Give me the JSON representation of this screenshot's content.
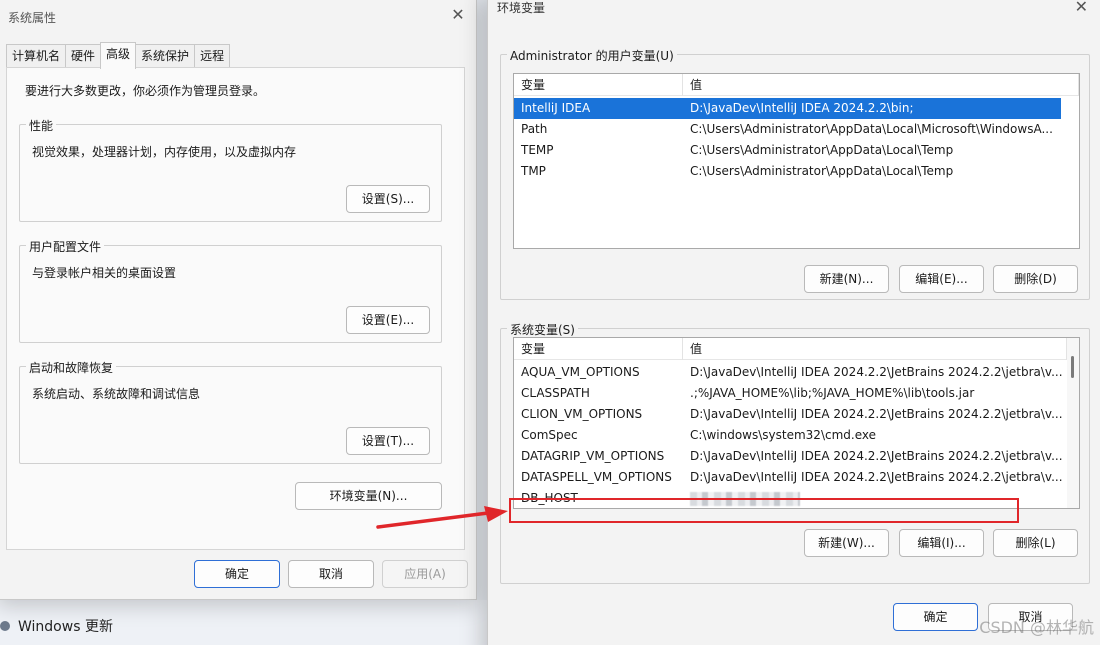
{
  "sys_props": {
    "title": "系统属性",
    "tabs": [
      "计算机名",
      "硬件",
      "高级",
      "系统保护",
      "远程"
    ],
    "active_tab": "高级",
    "admin_note": "要进行大多数更改，你必须作为管理员登录。",
    "performance": {
      "legend": "性能",
      "desc": "视觉效果，处理器计划，内存使用，以及虚拟内存",
      "button": "设置(S)..."
    },
    "user_profiles": {
      "legend": "用户配置文件",
      "desc": "与登录帐户相关的桌面设置",
      "button": "设置(E)..."
    },
    "startup_recovery": {
      "legend": "启动和故障恢复",
      "desc": "系统启动、系统故障和调试信息",
      "button": "设置(T)..."
    },
    "env_button": "环境变量(N)...",
    "ok": "确定",
    "cancel": "取消",
    "apply": "应用(A)"
  },
  "background": {
    "windows_update": "Windows 更新"
  },
  "env_dialog": {
    "title": "环境变量",
    "user_vars": {
      "legend": "Administrator 的用户变量(U)",
      "col_var": "变量",
      "col_val": "值",
      "rows": [
        {
          "name": "IntelliJ IDEA",
          "value": "D:\\JavaDev\\IntelliJ IDEA 2024.2.2\\bin;"
        },
        {
          "name": "Path",
          "value": "C:\\Users\\Administrator\\AppData\\Local\\Microsoft\\WindowsA..."
        },
        {
          "name": "TEMP",
          "value": "C:\\Users\\Administrator\\AppData\\Local\\Temp"
        },
        {
          "name": "TMP",
          "value": "C:\\Users\\Administrator\\AppData\\Local\\Temp"
        }
      ],
      "new": "新建(N)...",
      "edit": "编辑(E)...",
      "delete": "删除(D)"
    },
    "sys_vars": {
      "legend": "系统变量(S)",
      "col_var": "变量",
      "col_val": "值",
      "rows": [
        {
          "name": "AQUA_VM_OPTIONS",
          "value": "D:\\JavaDev\\IntelliJ IDEA 2024.2.2\\JetBrains  2024.2.2\\jetbra\\v..."
        },
        {
          "name": "CLASSPATH",
          "value": ".;%JAVA_HOME%\\lib;%JAVA_HOME%\\lib\\tools.jar"
        },
        {
          "name": "CLION_VM_OPTIONS",
          "value": "D:\\JavaDev\\IntelliJ IDEA 2024.2.2\\JetBrains  2024.2.2\\jetbra\\v..."
        },
        {
          "name": "ComSpec",
          "value": "C:\\windows\\system32\\cmd.exe"
        },
        {
          "name": "DATAGRIP_VM_OPTIONS",
          "value": "D:\\JavaDev\\IntelliJ IDEA 2024.2.2\\JetBrains  2024.2.2\\jetbra\\v..."
        },
        {
          "name": "DATASPELL_VM_OPTIONS",
          "value": "D:\\JavaDev\\IntelliJ IDEA 2024.2.2\\JetBrains  2024.2.2\\jetbra\\v..."
        },
        {
          "name": "DB_HOST",
          "value": ""
        }
      ],
      "new": "新建(W)...",
      "edit": "编辑(I)...",
      "delete": "删除(L)"
    },
    "ok": "确定",
    "cancel": "取消"
  },
  "watermark": "CSDN @林华航",
  "colors": {
    "selection": "#1a73d9",
    "highlight": "#e0262a",
    "arrow": "#e0262a"
  }
}
